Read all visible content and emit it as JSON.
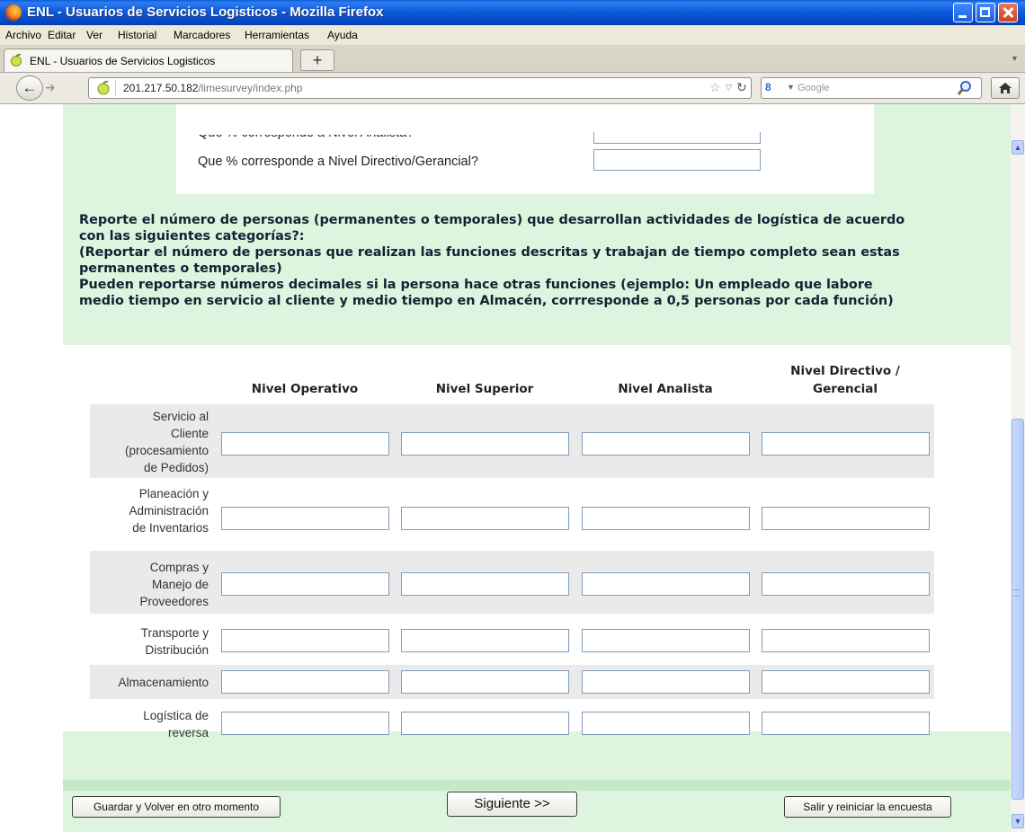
{
  "window": {
    "title": "ENL - Usuarios de Servicios Logisticos - Mozilla Firefox"
  },
  "menu": [
    "Archivo",
    "Editar",
    "Ver",
    "Historial",
    "Marcadores",
    "Herramientas",
    "Ayuda"
  ],
  "tab": {
    "label": "ENL - Usuarios de Servicios Logisticos",
    "new_tab_label": "+"
  },
  "nav": {
    "url_host": "201.217.50.182",
    "url_path": "/limesurvey/index.php",
    "search_placeholder": "Google"
  },
  "previous_question": {
    "rows": [
      {
        "label": "Que % corresponde a Nivel Analista?",
        "value": ""
      },
      {
        "label": "Que % corresponde a Nivel Directivo/Gerancial?",
        "value": ""
      }
    ]
  },
  "question": {
    "lines": [
      "Reporte el número de personas (permanentes o temporales) que desarrollan actividades de logística de acuerdo",
      "con las siguientes categorías?:",
      "(Reportar el número de personas que realizan las funciones descritas y trabajan de tiempo completo sean estas",
      "permanentes o temporales)",
      "Pueden reportarse números decimales si la persona hace otras funciones (ejemplo: Un empleado que labore",
      "medio tiempo en servicio al cliente y medio tiempo en Almacén, corrresponde a 0,5 personas por cada función)"
    ]
  },
  "matrix": {
    "columns": [
      "Nivel Operativo",
      "Nivel Superior",
      "Nivel Analista",
      "Nivel Directivo / Gerencial"
    ],
    "columns_split": [
      [
        "Nivel Operativo"
      ],
      [
        "Nivel Superior"
      ],
      [
        "Nivel Analista"
      ],
      [
        "Nivel Directivo /",
        "Gerencial"
      ]
    ],
    "rows": [
      {
        "label_lines": [
          "Servicio al",
          "Cliente",
          "(procesamiento",
          "de Pedidos)"
        ],
        "values": [
          "",
          "",
          "",
          ""
        ]
      },
      {
        "label_lines": [
          "Planeación y",
          "Administración",
          "de Inventarios"
        ],
        "values": [
          "",
          "",
          "",
          ""
        ]
      },
      {
        "label_lines": [
          "Compras y",
          "Manejo de",
          "Proveedores"
        ],
        "values": [
          "",
          "",
          "",
          ""
        ]
      },
      {
        "label_lines": [
          "Transporte y",
          "Distribución"
        ],
        "values": [
          "",
          "",
          "",
          ""
        ]
      },
      {
        "label_lines": [
          "Almacenamiento"
        ],
        "values": [
          "",
          "",
          "",
          ""
        ]
      },
      {
        "label_lines": [
          "Logística de",
          "reversa"
        ],
        "values": [
          "",
          "",
          "",
          ""
        ]
      }
    ]
  },
  "buttons": {
    "save": "Guardar y Volver en otro momento",
    "next": "Siguiente >>",
    "exit": "Salir y reiniciar la encuesta"
  }
}
